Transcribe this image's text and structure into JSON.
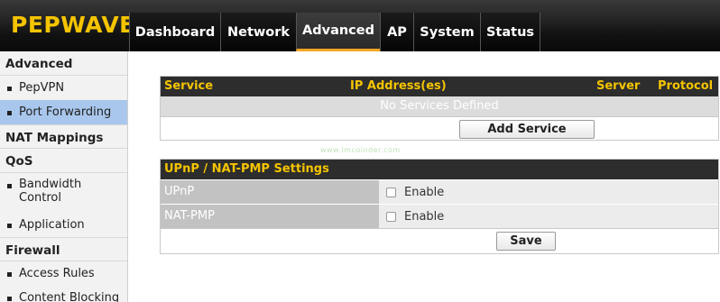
{
  "header": {
    "logo": "PEPWAVE",
    "tabs": [
      {
        "label": "Dashboard",
        "active": false
      },
      {
        "label": "Network",
        "active": false
      },
      {
        "label": "Advanced",
        "active": true
      },
      {
        "label": "AP",
        "active": false
      },
      {
        "label": "System",
        "active": false
      },
      {
        "label": "Status",
        "active": false
      }
    ]
  },
  "sidebar": {
    "sections": [
      {
        "heading": "Advanced",
        "items": [
          "PepVPN",
          "Port Forwarding"
        ]
      },
      {
        "heading": "NAT Mappings",
        "items": []
      },
      {
        "heading": "QoS",
        "items": [
          "Bandwidth Control",
          "Application"
        ]
      },
      {
        "heading": "Firewall",
        "items": [
          "Access Rules",
          "Content Blocking"
        ]
      }
    ],
    "bandwidth_line1": "Bandwidth",
    "bandwidth_line2": "Control",
    "active_item": "Port Forwarding"
  },
  "services": {
    "columns": [
      "Service",
      "IP Address(es)",
      "Server",
      "Protocol"
    ],
    "empty_text": "No Services Defined",
    "add_button": "Add Service"
  },
  "upnp": {
    "title": "UPnP / NAT-PMP Settings",
    "rows": [
      {
        "label": "UPnP",
        "option": "Enable",
        "checked": false
      },
      {
        "label": "NAT-PMP",
        "option": "Enable",
        "checked": false
      }
    ],
    "save_button": "Save"
  },
  "watermark": "www.lmcoinder.com",
  "colors": {
    "accent": "#f5c400",
    "active_tab_underline": "#f5a623",
    "sidebar_active": "#a9c7ec"
  }
}
